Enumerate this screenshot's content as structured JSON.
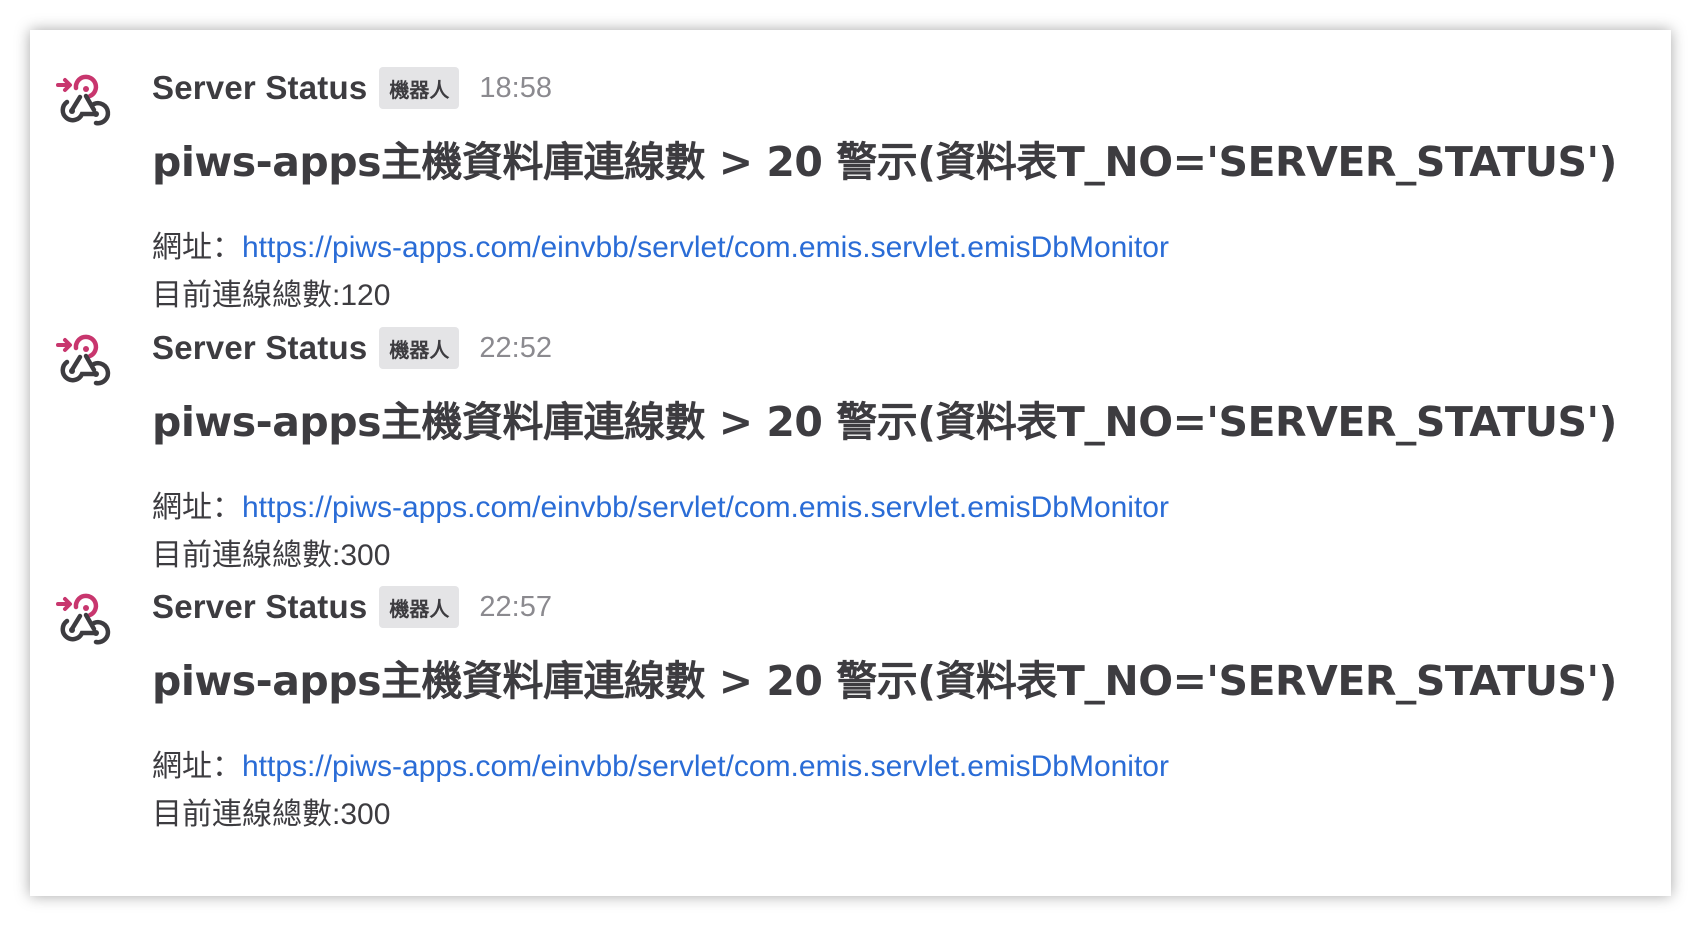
{
  "colors": {
    "accent_link": "#2a6cd6",
    "icon_pink": "#c8366e",
    "icon_dark": "#3d3c40",
    "bot_tag_bg": "#e4e4e6"
  },
  "messages": [
    {
      "avatar_icon": "webhook-icon",
      "sender": "Server Status",
      "bot_tag": "機器人",
      "time": "18:58",
      "title": "piws-apps主機資料庫連線數 > 20 警示(資料表T_NO='SERVER_STATUS')",
      "url_label": "網址：",
      "url": "https://piws-apps.com/einvbb/servlet/com.emis.servlet.emisDbMonitor",
      "count": "目前連線總數:120"
    },
    {
      "avatar_icon": "webhook-icon",
      "sender": "Server Status",
      "bot_tag": "機器人",
      "time": "22:52",
      "title": "piws-apps主機資料庫連線數 > 20 警示(資料表T_NO='SERVER_STATUS')",
      "url_label": "網址：",
      "url": "https://piws-apps.com/einvbb/servlet/com.emis.servlet.emisDbMonitor",
      "count": "目前連線總數:300"
    },
    {
      "avatar_icon": "webhook-icon",
      "sender": "Server Status",
      "bot_tag": "機器人",
      "time": "22:57",
      "title": "piws-apps主機資料庫連線數 > 20 警示(資料表T_NO='SERVER_STATUS')",
      "url_label": "網址：",
      "url": "https://piws-apps.com/einvbb/servlet/com.emis.servlet.emisDbMonitor",
      "count": "目前連線總數:300"
    }
  ]
}
